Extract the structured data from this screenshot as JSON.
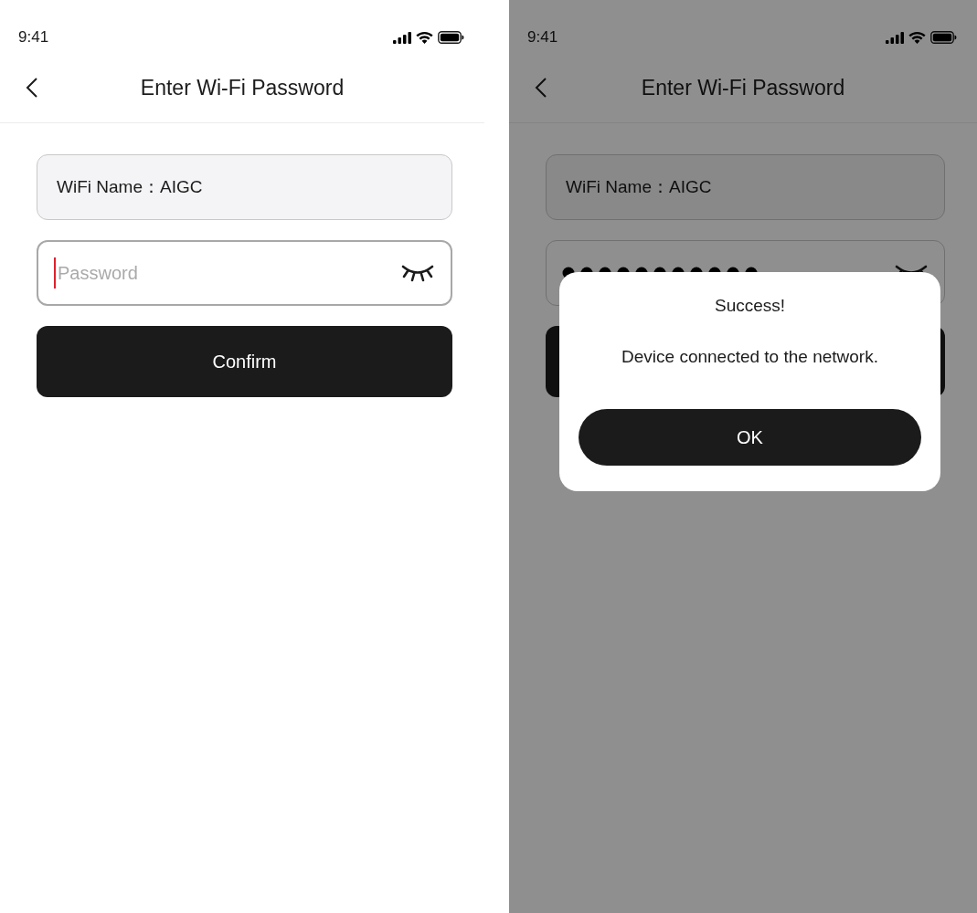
{
  "screens": [
    {
      "status_bar": {
        "time": "9:41"
      },
      "title": "Enter Wi‑Fi Password",
      "wifi_name": {
        "label": "WiFi Name：",
        "value": "AIGC"
      },
      "password": {
        "placeholder": "Password",
        "masked": false,
        "focused": true
      },
      "confirm_button": "Confirm",
      "dimmed": false
    },
    {
      "status_bar": {
        "time": "9:41"
      },
      "title": "Enter Wi‑Fi Password",
      "wifi_name": {
        "label": "WiFi Name：",
        "value": "AIGC"
      },
      "password": {
        "masked": true,
        "focused": false
      },
      "dimmed": true,
      "dialog": {
        "title": "Success!",
        "message": "Device connected to the network.",
        "button": "OK"
      }
    }
  ]
}
